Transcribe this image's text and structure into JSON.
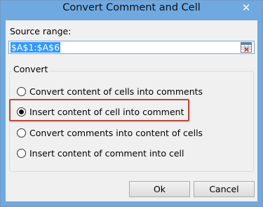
{
  "window": {
    "title": "Convert Comment and Cell",
    "close_glyph": "✕"
  },
  "source": {
    "label": "Source range:",
    "value": "$A$1:$A$6",
    "picker_icon": "range-select-icon"
  },
  "convert": {
    "group_label": "Convert",
    "options": [
      {
        "label": "Convert content of cells into comments",
        "selected": false
      },
      {
        "label": "Insert content of cell into comment",
        "selected": true
      },
      {
        "label": "Convert comments into content of cells",
        "selected": false
      },
      {
        "label": "Insert content of comment into cell",
        "selected": false
      }
    ]
  },
  "buttons": {
    "ok": "Ok",
    "cancel": "Cancel"
  },
  "colors": {
    "title_bar": "#6fa9e0",
    "highlight_border": "#b84a3c",
    "selection": "#3399ff"
  }
}
